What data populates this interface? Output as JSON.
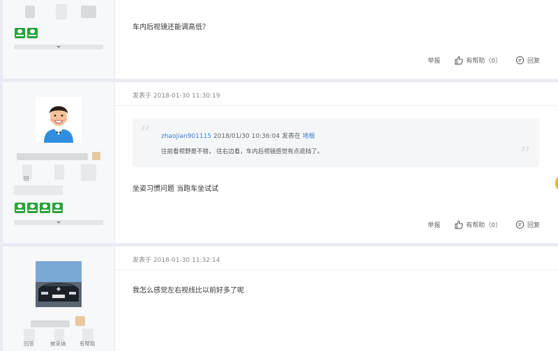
{
  "posts": [
    {
      "content": "车内后视镜还能调高低？",
      "actions": {
        "report": "举报",
        "helpful": "有帮助（0）",
        "reply": "回复"
      }
    },
    {
      "meta": "发表于 2018-01-30 11:30:19",
      "quote": {
        "user": "zhaojian901115",
        "time": "2018/01/30 10:36:04",
        "posted_in": "发表在",
        "floor": "地板",
        "text": "往前看视野是不错， 往右边看，车内后视镜感觉有点遮挡了。"
      },
      "content": "坐姿习惯问题 当跑车坐试试",
      "side_label": "回",
      "actions": {
        "report": "举报",
        "helpful": "有帮助（0）",
        "reply": "回复"
      }
    },
    {
      "meta": "发表于 2018-01-30 11:32:14",
      "content": "我怎么感觉左右视线比以前好多了呢",
      "side_stats": [
        "回答",
        "被采纳",
        "有帮助"
      ]
    }
  ]
}
